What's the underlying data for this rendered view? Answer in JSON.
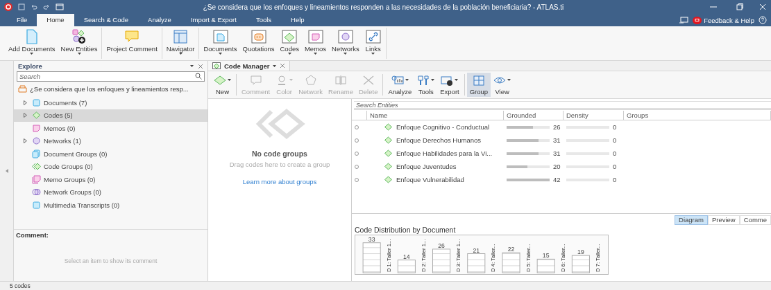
{
  "window": {
    "title": "¿Se considera que los enfoques y lineamientos responden a las necesidades de la población beneficiaria? - ATLAS.ti"
  },
  "menu_tabs": [
    {
      "label": "File",
      "selected": false
    },
    {
      "label": "Home",
      "selected": true
    },
    {
      "label": "Search & Code",
      "selected": false
    },
    {
      "label": "Analyze",
      "selected": false
    },
    {
      "label": "Import & Export",
      "selected": false
    },
    {
      "label": "Tools",
      "selected": false
    },
    {
      "label": "Help",
      "selected": false
    }
  ],
  "help": {
    "label": "Feedback & Help"
  },
  "ribbon": [
    {
      "buttons": [
        {
          "label": "Add Documents",
          "kind": "add-document",
          "dropdown": true
        },
        {
          "label": "New Entities",
          "kind": "new-entities",
          "dropdown": true
        }
      ]
    },
    {
      "buttons": [
        {
          "label": "Project Comment",
          "kind": "project-comment",
          "dropdown": false
        }
      ]
    },
    {
      "buttons": [
        {
          "label": "Navigator",
          "kind": "navigator",
          "dropdown": true
        }
      ]
    },
    {
      "buttons": [
        {
          "label": "Documents",
          "kind": "documents",
          "dropdown": true
        },
        {
          "label": "Quotations",
          "kind": "quotations",
          "dropdown": false
        },
        {
          "label": "Codes",
          "kind": "codes",
          "dropdown": true
        },
        {
          "label": "Memos",
          "kind": "memos",
          "dropdown": true
        },
        {
          "label": "Networks",
          "kind": "networks",
          "dropdown": true
        },
        {
          "label": "Links",
          "kind": "links",
          "dropdown": true
        }
      ]
    }
  ],
  "explore": {
    "title": "Explore",
    "search_placeholder": "Search",
    "project": "¿Se considera que los enfoques y lineamientos resp...",
    "items": [
      {
        "label": "Documents (7)",
        "kind": "documents",
        "has_children": true,
        "selected": false
      },
      {
        "label": "Codes (5)",
        "kind": "codes",
        "has_children": true,
        "selected": true
      },
      {
        "label": "Memos (0)",
        "kind": "memos",
        "has_children": false,
        "selected": false
      },
      {
        "label": "Networks (1)",
        "kind": "networks",
        "has_children": true,
        "selected": false
      },
      {
        "label": "Document Groups (0)",
        "kind": "document-groups",
        "has_children": false,
        "selected": false
      },
      {
        "label": "Code Groups (0)",
        "kind": "code-groups",
        "has_children": false,
        "selected": false
      },
      {
        "label": "Memo Groups (0)",
        "kind": "memo-groups",
        "has_children": false,
        "selected": false
      },
      {
        "label": "Network Groups (0)",
        "kind": "network-groups",
        "has_children": false,
        "selected": false
      },
      {
        "label": "Multimedia Transcripts (0)",
        "kind": "transcripts",
        "has_children": false,
        "selected": false
      }
    ],
    "comment_label": "Comment:",
    "comment_hint": "Select an item to show its comment"
  },
  "code_manager": {
    "tab": "Code Manager",
    "toolbar": [
      {
        "label": "New",
        "kind": "new",
        "dropdown": true,
        "disabled": false,
        "selected": false,
        "separator_after": true
      },
      {
        "label": "Comment",
        "kind": "comment",
        "dropdown": false,
        "disabled": true,
        "selected": false,
        "separator_after": false
      },
      {
        "label": "Color",
        "kind": "color",
        "dropdown": true,
        "disabled": true,
        "selected": false,
        "separator_after": false
      },
      {
        "label": "Network",
        "kind": "network",
        "dropdown": false,
        "disabled": true,
        "selected": false,
        "separator_after": false
      },
      {
        "label": "Rename",
        "kind": "rename",
        "dropdown": false,
        "disabled": true,
        "selected": false,
        "separator_after": false
      },
      {
        "label": "Delete",
        "kind": "delete",
        "dropdown": false,
        "disabled": true,
        "selected": false,
        "separator_after": true
      },
      {
        "label": "Analyze",
        "kind": "analyze",
        "dropdown": true,
        "disabled": false,
        "selected": false,
        "separator_after": false
      },
      {
        "label": "Tools",
        "kind": "tools",
        "dropdown": true,
        "disabled": false,
        "selected": false,
        "separator_after": false
      },
      {
        "label": "Export",
        "kind": "export",
        "dropdown": true,
        "disabled": false,
        "selected": false,
        "separator_after": true
      },
      {
        "label": "Group",
        "kind": "group",
        "dropdown": false,
        "disabled": false,
        "selected": true,
        "separator_after": false
      },
      {
        "label": "View",
        "kind": "view",
        "dropdown": true,
        "disabled": false,
        "selected": false,
        "separator_after": false
      }
    ],
    "groups_pane": {
      "title": "No code groups",
      "hint": "Drag codes here to create a group",
      "link": "Learn more about groups"
    },
    "search_placeholder": "Search Entities",
    "columns": [
      "Name",
      "Grounded",
      "Density",
      "Groups"
    ],
    "rows": [
      {
        "name": "Enfoque Cognitivo - Conductual",
        "grounded": {
          "value": "26",
          "level": 0.62
        },
        "density": {
          "value": "0",
          "level": 0
        }
      },
      {
        "name": "Enfoque Derechos Humanos",
        "grounded": {
          "value": "31",
          "level": 0.74
        },
        "density": {
          "value": "0",
          "level": 0
        }
      },
      {
        "name": "Enfoque Habilidades para la Vi...",
        "grounded": {
          "value": "31",
          "level": 0.74
        },
        "density": {
          "value": "0",
          "level": 0
        }
      },
      {
        "name": "Enfoque Juventudes",
        "grounded": {
          "value": "20",
          "level": 0.48
        },
        "density": {
          "value": "0",
          "level": 0
        }
      },
      {
        "name": "Enfoque Vulnerabilidad",
        "grounded": {
          "value": "42",
          "level": 1
        },
        "density": {
          "value": "0",
          "level": 0
        }
      }
    ],
    "view_tabs": [
      {
        "label": "Diagram",
        "selected": true
      },
      {
        "label": "Preview",
        "selected": false
      },
      {
        "label": "Comme",
        "selected": false
      }
    ],
    "chart": {
      "chart_data": {
        "type": "bar",
        "title": "Code Distribution by Document",
        "categories": [
          "D 1: Taller 1...",
          "D 2: Taller 1...",
          "D 3: Taller 1...",
          "D 4: Taller...",
          "D 5: Taller...",
          "D 6: Taller...",
          "D 7: Taller..."
        ],
        "values": [
          33,
          14,
          26,
          21,
          22,
          15,
          19
        ],
        "data_labels": true
      }
    }
  },
  "status_bar": "5 codes"
}
